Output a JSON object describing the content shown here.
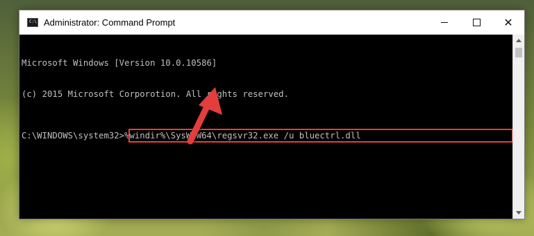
{
  "window": {
    "title": "Administrator: Command Prompt",
    "icon": "cmd-icon",
    "icon_text": "C:\\"
  },
  "controls": {
    "minimize": "minimize-icon",
    "maximize": "maximize-icon",
    "close": "close-icon",
    "close_glyph": "✕"
  },
  "console": {
    "line1": "Microsoft Windows [Version 10.0.10586]",
    "line2": "(c) 2015 Microsoft Corporotion. All rights reserved.",
    "prompt": "C:\\WINDOWS\\system32>",
    "command": "%windir%\\SysWoW64\\regsvr32.exe /u bluectrl.dll"
  },
  "colors": {
    "highlight": "#e53e3e",
    "console_bg": "#000000",
    "console_text": "#c0c0c0"
  }
}
